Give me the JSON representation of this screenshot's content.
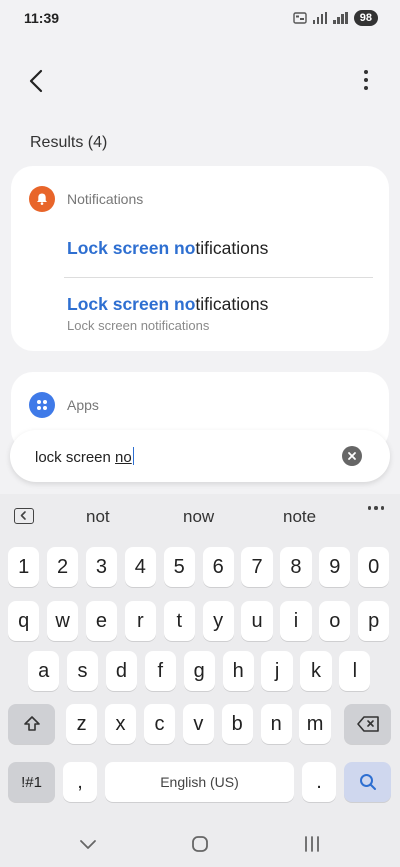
{
  "status": {
    "time": "11:39",
    "battery": "98"
  },
  "results_title": "Results (4)",
  "notifications": {
    "category": "Notifications",
    "items": [
      {
        "match": "Lock screen no",
        "rest": "tifications",
        "sub": ""
      },
      {
        "match": "Lock screen no",
        "rest": "tifications",
        "sub": "Lock screen notifications"
      }
    ]
  },
  "apps": {
    "category": "Apps"
  },
  "search": {
    "typed_plain": "lock screen ",
    "typed_composing": "no"
  },
  "suggestions": [
    "not",
    "now",
    "note"
  ],
  "keyboard": {
    "numbers": [
      "1",
      "2",
      "3",
      "4",
      "5",
      "6",
      "7",
      "8",
      "9",
      "0"
    ],
    "row1": [
      "q",
      "w",
      "e",
      "r",
      "t",
      "y",
      "u",
      "i",
      "o",
      "p"
    ],
    "row2": [
      "a",
      "s",
      "d",
      "f",
      "g",
      "h",
      "j",
      "k",
      "l"
    ],
    "row3": [
      "z",
      "x",
      "c",
      "v",
      "b",
      "n",
      "m"
    ],
    "symbols_label": "!#1",
    "comma": ",",
    "space_label": "English (US)",
    "period": "."
  },
  "colors": {
    "accent": "#2e6fd1",
    "notif_icon": "#e8652a",
    "apps_icon": "#3f7ae8"
  }
}
